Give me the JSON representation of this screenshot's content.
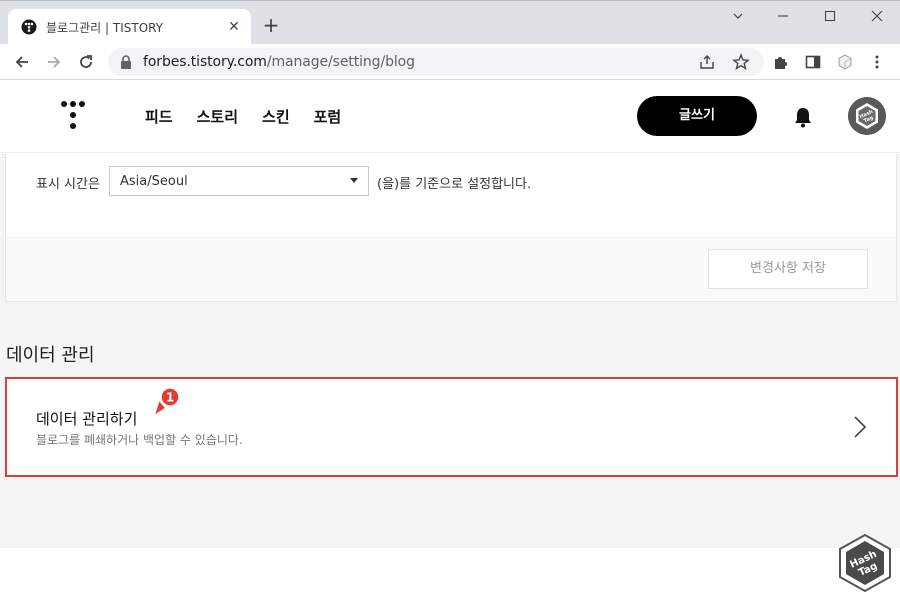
{
  "browser": {
    "tab_title": "블로그관리 | TISTORY",
    "url_host": "forbes.tistory.com",
    "url_path": "/manage/setting/blog"
  },
  "site": {
    "nav": [
      "피드",
      "스토리",
      "스킨",
      "포럼"
    ],
    "write_label": "글쓰기",
    "avatar_text": "Hash Tag"
  },
  "timezone": {
    "label": "표시 시간은",
    "value": "Asia/Seoul",
    "suffix": "(을)를 기준으로 설정합니다."
  },
  "save_label": "변경사항 저장",
  "data_section": {
    "title": "데이터 관리",
    "item_title": "데이터 관리하기",
    "item_desc": "블로그를 폐쇄하거나 백업할 수 있습니다."
  },
  "callout_number": "1",
  "watermark": "Hash Tag",
  "colors": {
    "highlight_border": "#e53935",
    "callout": "#e53935",
    "write_button": "#000000"
  }
}
